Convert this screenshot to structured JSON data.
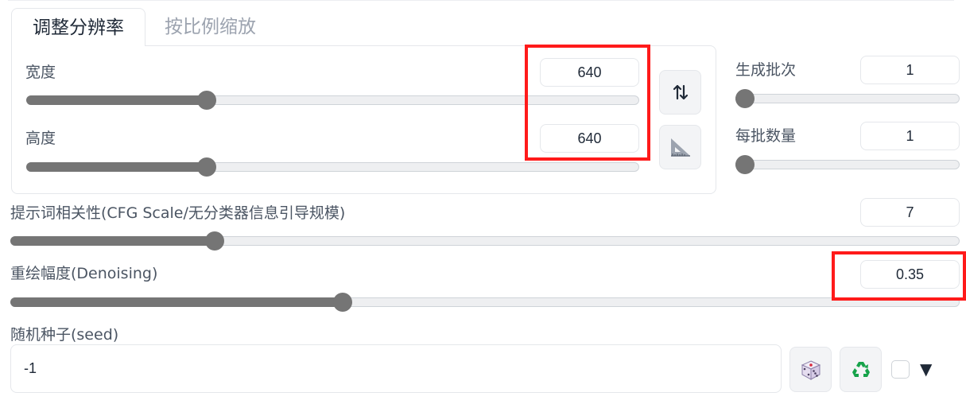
{
  "tabs": [
    {
      "label": "调整分辨率",
      "active": true
    },
    {
      "label": "按比例缩放",
      "active": false
    }
  ],
  "width": {
    "label": "宽度",
    "value": "640",
    "fraction": 0.295
  },
  "height": {
    "label": "高度",
    "value": "640",
    "fraction": 0.295
  },
  "batch_count": {
    "label": "生成批次",
    "value": "1",
    "fraction": 0.0
  },
  "batch_size": {
    "label": "每批数量",
    "value": "1",
    "fraction": 0.0
  },
  "cfg_scale": {
    "label": "提示词相关性(CFG Scale/无分类器信息引导规模)",
    "value": "7",
    "fraction": 0.215
  },
  "denoising": {
    "label": "重绘幅度(Denoising)",
    "value": "0.35",
    "fraction": 0.35
  },
  "seed": {
    "label": "随机种子(seed)",
    "value": "-1"
  },
  "icons": {
    "swap": "swap-arrows-icon",
    "ratio": "set-square-icon",
    "random": "dice-icon",
    "reuse": "recycle-icon",
    "dropdown": "▼"
  },
  "colors": {
    "highlight": "#ff1a1a",
    "slider": "#757575",
    "recycle": "#16a34a"
  }
}
